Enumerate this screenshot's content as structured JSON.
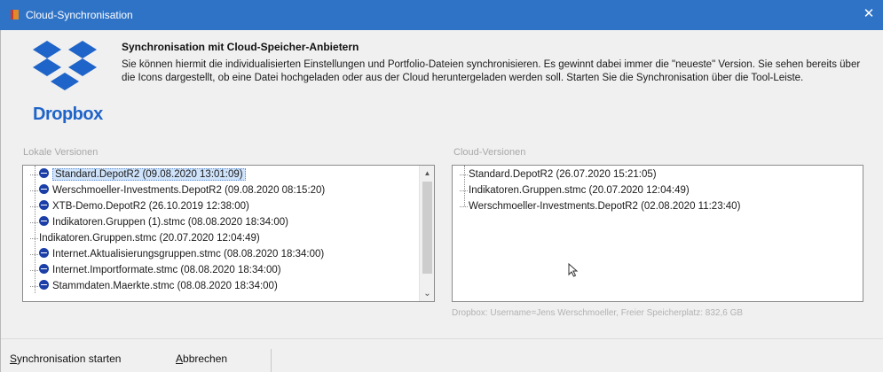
{
  "window": {
    "title": "Cloud-Synchronisation",
    "close_glyph": "✕",
    "accent_color": "#2f73c7"
  },
  "header": {
    "logo_word": "Dropbox",
    "logo_color": "#1f64c8",
    "heading": "Synchronisation mit Cloud-Speicher-Anbietern",
    "description": "Sie können hiermit die individualisierten Einstellungen und Portfolio-Dateien synchronisieren.  Es gewinnt dabei immer die \"neueste\" Version. Sie sehen bereits über die Icons dargestellt, ob eine Datei hochgeladen oder aus der Cloud heruntergeladen werden soll. Starten Sie die Synchronisation über die Tool-Leiste."
  },
  "local": {
    "label": "Lokale Versionen",
    "items": [
      {
        "text": "Standard.DepotR2 (09.08.2020 13:01:09)",
        "icon": "upload-icon",
        "selected": true
      },
      {
        "text": "Werschmoeller-Investments.DepotR2 (09.08.2020 08:15:20)",
        "icon": "upload-icon"
      },
      {
        "text": "XTB-Demo.DepotR2 (26.10.2019 12:38:00)",
        "icon": "upload-icon"
      },
      {
        "text": "Indikatoren.Gruppen (1).stmc (08.08.2020 18:34:00)",
        "icon": "upload-icon"
      },
      {
        "text": "Indikatoren.Gruppen.stmc (20.07.2020 12:04:49)",
        "icon": ""
      },
      {
        "text": "Internet.Aktualisierungsgruppen.stmc (08.08.2020 18:34:00)",
        "icon": "upload-icon"
      },
      {
        "text": "Internet.Importformate.stmc (08.08.2020 18:34:00)",
        "icon": "upload-icon"
      },
      {
        "text": "Stammdaten.Maerkte.stmc (08.08.2020 18:34:00)",
        "icon": "upload-icon"
      }
    ],
    "scroll_up": "▲",
    "scroll_down": "⌄"
  },
  "cloud": {
    "label": "Cloud-Versionen",
    "items": [
      {
        "text": "Standard.DepotR2 (26.07.2020 15:21:05)"
      },
      {
        "text": "Indikatoren.Gruppen.stmc (20.07.2020 12:04:49)"
      },
      {
        "text": "Werschmoeller-Investments.DepotR2 (02.08.2020 11:23:40)"
      }
    ]
  },
  "status": {
    "info": "Dropbox: Username=Jens Werschmoeller, Freier Speicherplatz: 832,6 GB"
  },
  "toolbar": {
    "sync_mnemonic": "S",
    "sync_rest": "ynchronisation starten",
    "cancel_mnemonic": "A",
    "cancel_rest": "bbrechen"
  }
}
